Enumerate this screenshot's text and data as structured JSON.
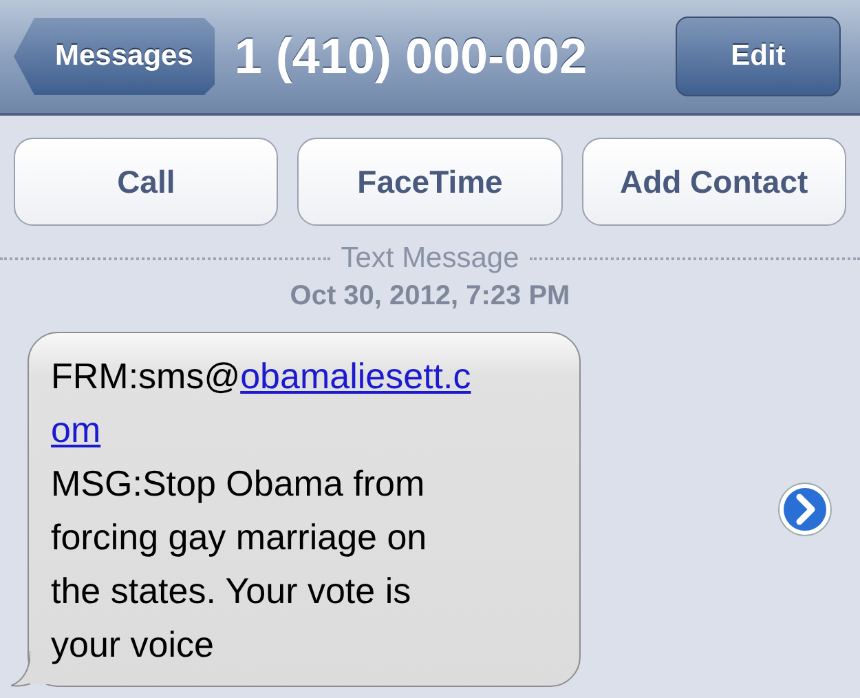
{
  "nav_bar": {
    "back_button": "Messages",
    "title": "1 (410) 000-002",
    "edit_button": "Edit"
  },
  "actions": [
    "Call",
    "FaceTime",
    "Add Contact"
  ],
  "separator": "Text Message",
  "timestamp": "Oct 30, 2012, 7:23 PM",
  "message": {
    "prefix": "FRM:sms@",
    "link_lines": [
      "obamaliesett.c",
      "om"
    ],
    "body_lines": [
      "MSG:Stop Obama from",
      "forcing gay marriage on",
      "the states. Your vote is",
      "your voice"
    ]
  }
}
